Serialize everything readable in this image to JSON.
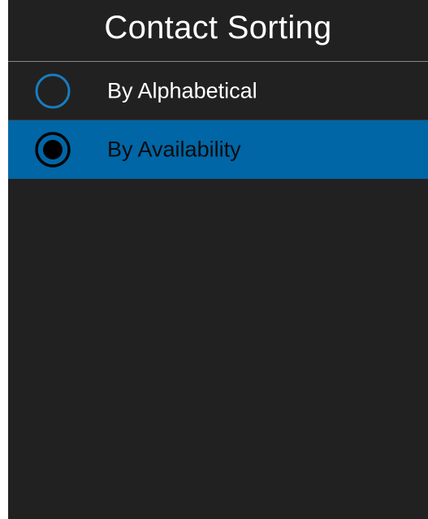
{
  "header": {
    "title": "Contact Sorting"
  },
  "options": [
    {
      "label": "By Alphabetical",
      "selected": false
    },
    {
      "label": "By Availability",
      "selected": true
    }
  ],
  "colors": {
    "background": "#212121",
    "selected_row": "#0066a6",
    "radio_unselected": "#1a7cc1",
    "radio_selected": "#000000"
  }
}
